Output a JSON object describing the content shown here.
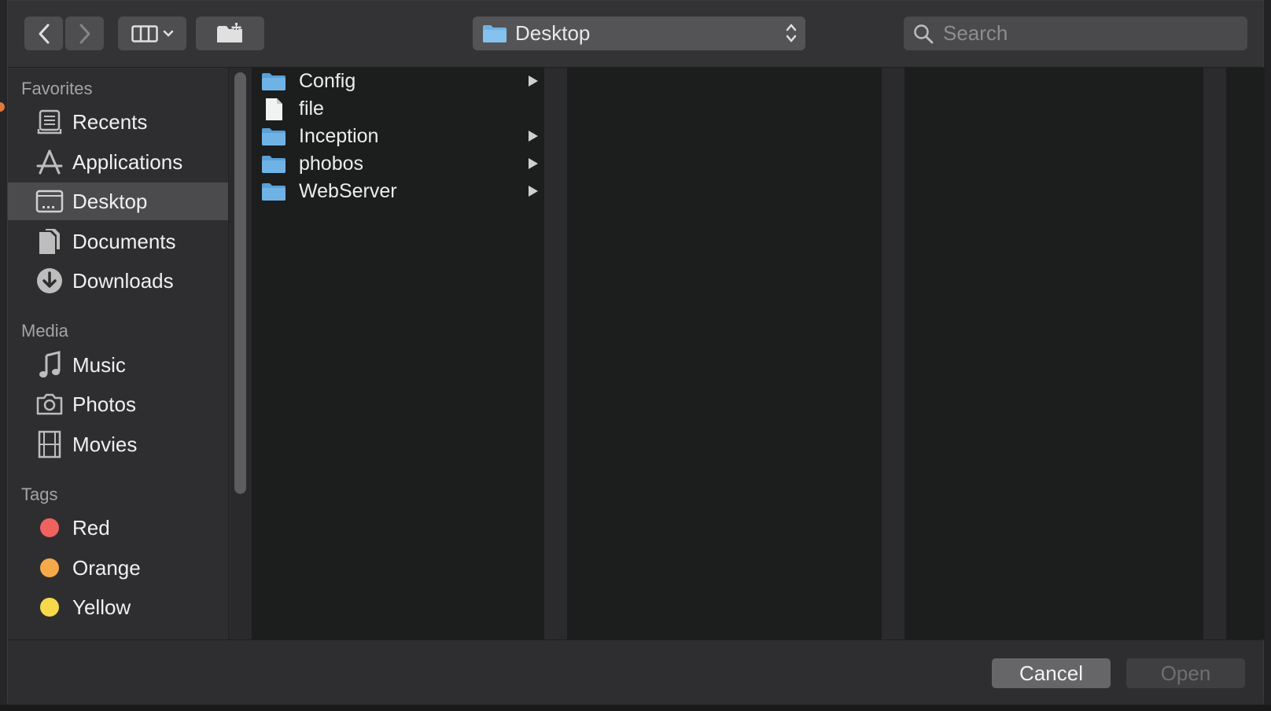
{
  "toolbar": {
    "path_label": "Desktop",
    "search_placeholder": "Search"
  },
  "sidebar": {
    "sections": {
      "favorites": "Favorites",
      "media": "Media",
      "tags": "Tags"
    },
    "favorites": [
      {
        "label": "Recents",
        "icon": "recents-icon"
      },
      {
        "label": "Applications",
        "icon": "applications-icon"
      },
      {
        "label": "Desktop",
        "icon": "desktop-icon",
        "selected": true
      },
      {
        "label": "Documents",
        "icon": "documents-icon"
      },
      {
        "label": "Downloads",
        "icon": "downloads-icon"
      }
    ],
    "media": [
      {
        "label": "Music",
        "icon": "music-icon"
      },
      {
        "label": "Photos",
        "icon": "photos-icon"
      },
      {
        "label": "Movies",
        "icon": "movies-icon"
      }
    ],
    "tags": [
      {
        "label": "Red",
        "color": "#f0625f"
      },
      {
        "label": "Orange",
        "color": "#f6a94a"
      },
      {
        "label": "Yellow",
        "color": "#f7d94a"
      }
    ]
  },
  "files": [
    {
      "name": "Config",
      "type": "folder",
      "has_children": true
    },
    {
      "name": "file",
      "type": "file",
      "has_children": false
    },
    {
      "name": "Inception",
      "type": "folder",
      "has_children": true
    },
    {
      "name": "phobos",
      "type": "folder",
      "has_children": true
    },
    {
      "name": "WebServer",
      "type": "folder",
      "has_children": true
    }
  ],
  "buttons": {
    "cancel": "Cancel",
    "open": "Open"
  },
  "colors": {
    "folder": "#6fb3e6",
    "selection": "#4b4b4d"
  }
}
